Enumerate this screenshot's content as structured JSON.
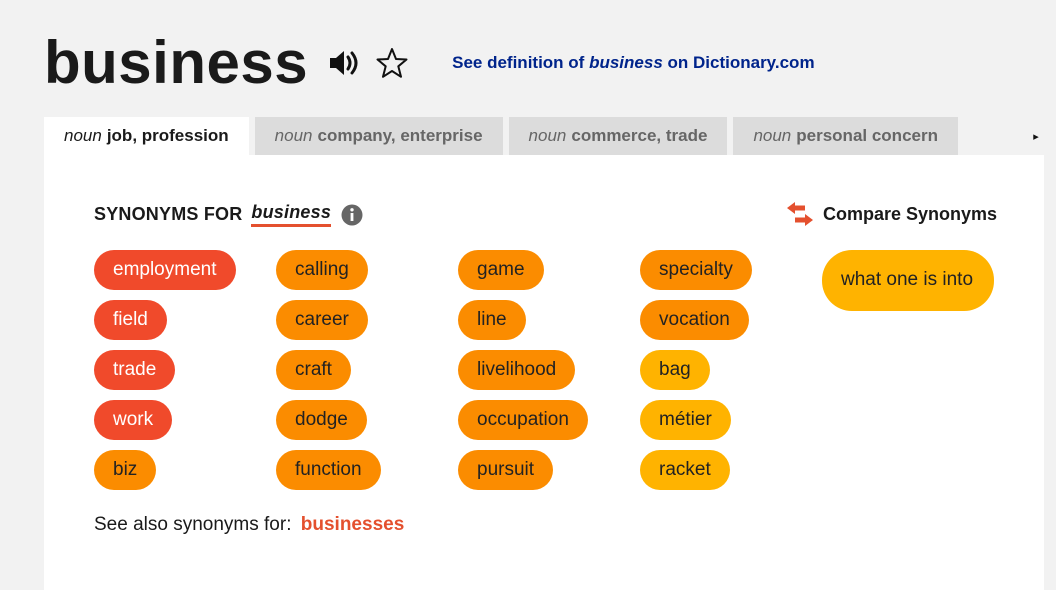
{
  "headword": "business",
  "icons": {
    "audio": "speaker-icon",
    "favorite": "star-outline-icon",
    "info": "info-icon",
    "compare": "swap-arrows-icon",
    "tabs_next": "triangle-right-icon"
  },
  "definition_link": {
    "prefix": "See definition of",
    "word": "business",
    "suffix": "on Dictionary.com"
  },
  "tabs": [
    {
      "pos": "noun",
      "label": "job, profession",
      "active": true
    },
    {
      "pos": "noun",
      "label": "company, enterprise",
      "active": false
    },
    {
      "pos": "noun",
      "label": "commerce, trade",
      "active": false
    },
    {
      "pos": "noun",
      "label": "personal concern",
      "active": false
    }
  ],
  "tabs_next_glyph": "▸",
  "synonyms_heading": {
    "label": "SYNONYMS FOR",
    "word": "business"
  },
  "compare_label": "Compare Synonyms",
  "colors": {
    "most_relevant": "#f04a2b",
    "relevant": "#fb8c00",
    "less_relevant": "#ffb300",
    "link": "#00248b",
    "accent": "#e4502e"
  },
  "synonyms": [
    {
      "word": "employment",
      "relevance": 1
    },
    {
      "word": "field",
      "relevance": 1
    },
    {
      "word": "trade",
      "relevance": 1
    },
    {
      "word": "work",
      "relevance": 1
    },
    {
      "word": "biz",
      "relevance": 2
    },
    {
      "word": "calling",
      "relevance": 2
    },
    {
      "word": "career",
      "relevance": 2
    },
    {
      "word": "craft",
      "relevance": 2
    },
    {
      "word": "dodge",
      "relevance": 2
    },
    {
      "word": "function",
      "relevance": 2
    },
    {
      "word": "game",
      "relevance": 2
    },
    {
      "word": "line",
      "relevance": 2
    },
    {
      "word": "livelihood",
      "relevance": 2
    },
    {
      "word": "occupation",
      "relevance": 2
    },
    {
      "word": "pursuit",
      "relevance": 2
    },
    {
      "word": "specialty",
      "relevance": 2
    },
    {
      "word": "vocation",
      "relevance": 2
    },
    {
      "word": "bag",
      "relevance": 3
    },
    {
      "word": "métier",
      "relevance": 3
    },
    {
      "word": "racket",
      "relevance": 3
    },
    {
      "word": "what one is into",
      "relevance": 3
    }
  ],
  "see_also": {
    "label": "See also synonyms for:",
    "link": "businesses"
  }
}
